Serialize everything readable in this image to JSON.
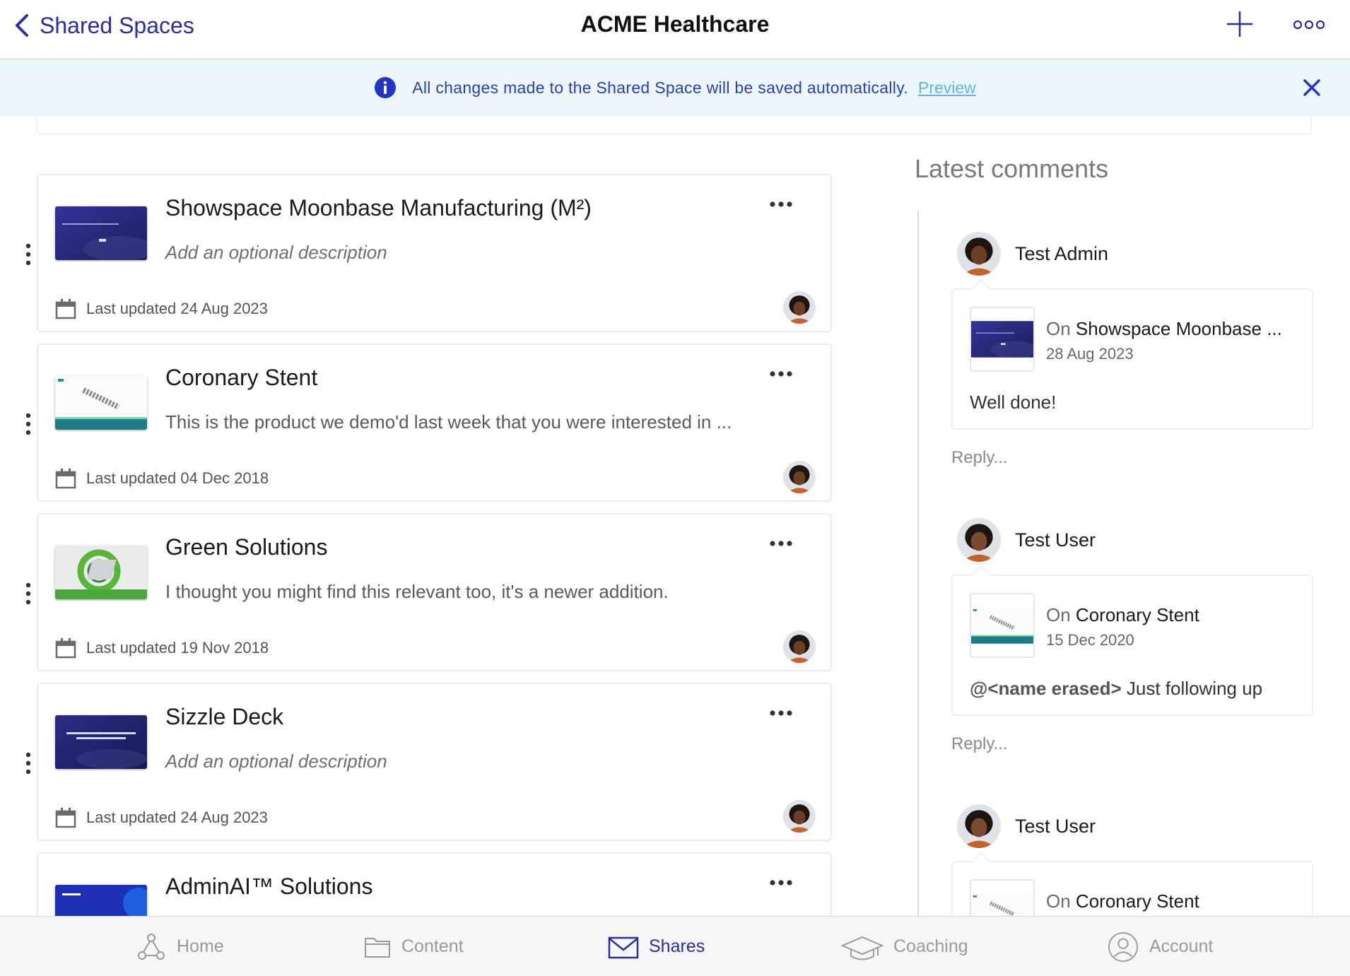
{
  "header": {
    "back_label": "Shared Spaces",
    "title": "ACME Healthcare"
  },
  "banner": {
    "message": "All changes made to the Shared Space will be saved automatically.",
    "link_label": "Preview"
  },
  "items": [
    {
      "title": "Showspace Moonbase Manufacturing (M²)",
      "description": "Add an optional description",
      "description_is_placeholder": true,
      "updated": "Last updated 24 Aug 2023",
      "thumb": "moonbase"
    },
    {
      "title": "Coronary Stent",
      "description": "This is the product we demo'd last week that you were interested in ...",
      "description_is_placeholder": false,
      "updated": "Last updated 04 Dec 2018",
      "thumb": "stent"
    },
    {
      "title": "Green Solutions",
      "description": "I thought you might find this relevant too, it's a newer addition.",
      "description_is_placeholder": false,
      "updated": "Last updated 19 Nov 2018",
      "thumb": "green"
    },
    {
      "title": "Sizzle Deck",
      "description": "Add an optional description",
      "description_is_placeholder": true,
      "updated": "Last updated 24 Aug 2023",
      "thumb": "sizzle"
    },
    {
      "title": "AdminAI™ Solutions",
      "description": "",
      "description_is_placeholder": false,
      "updated": "",
      "thumb": "adminai"
    }
  ],
  "comments": {
    "heading": "Latest comments",
    "list": [
      {
        "author": "Test Admin",
        "on_prefix": "On",
        "on_title": "Showspace Moonbase ...",
        "date": "28 Aug 2023",
        "mention": "",
        "text": "Well done!",
        "reply_placeholder": "Reply..."
      },
      {
        "author": "Test User",
        "on_prefix": "On",
        "on_title": "Coronary Stent",
        "date": "15 Dec 2020",
        "mention": "@<name erased>",
        "text": " Just following up",
        "reply_placeholder": "Reply..."
      },
      {
        "author": "Test User",
        "on_prefix": "On",
        "on_title": "Coronary Stent",
        "date": "",
        "mention": "",
        "text": "",
        "reply_placeholder": ""
      }
    ]
  },
  "nav": {
    "home": "Home",
    "content": "Content",
    "shares": "Shares",
    "coaching": "Coaching",
    "account": "Account",
    "active": "shares"
  },
  "colors": {
    "accent": "#2b2ea0",
    "banner_bg": "#eef6fd",
    "link": "#5bb6e7",
    "muted": "#9a9a9e"
  }
}
